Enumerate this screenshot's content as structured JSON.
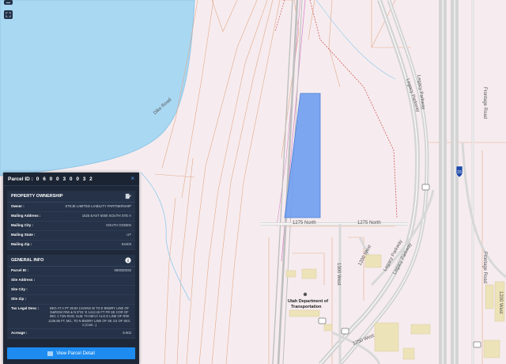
{
  "map": {
    "road_labels": {
      "dike_road": "Dike Road",
      "street_1275_a": "1275 North",
      "street_1275_b": "1275 North",
      "legacy_1": "Legacy Parkway",
      "legacy_2": "Legacy Parkway",
      "legacy_3": "Legacy Parkway",
      "legacy_4": "Legacy Parkway",
      "frontage_1": "Frontage Road",
      "frontage_2": "Frontage Road",
      "west_1200": "1200 West",
      "west_1300": "1300 West",
      "west_1200b": "1200 West",
      "west_1250": "1250 West"
    },
    "poi_utah_dot": "Utah Department of Transportation",
    "interstate_shield": "15",
    "parcel_highlight_color": "#6f9ff0",
    "water_color": "#a9d8f3"
  },
  "toolbar": {
    "zoom_button_icon": "minus-icon",
    "locate_button_icon": "expand-icon"
  },
  "panel": {
    "title": "Parcel ID :",
    "parcel_id": "0 6 0 0 3 0 0 3 2",
    "close_icon": "close-icon",
    "ownership": {
      "heading": "PROPERTY OWNERSHIP",
      "rows": [
        {
          "key": "Owner :",
          "value": "STEJE LIMITED LIABILITY PARTNERSHIP"
        },
        {
          "key": "Mailing Address :",
          "value": "1525 EAST 6000 SOUTH STE A"
        },
        {
          "key": "Mailing City :",
          "value": "SOUTH OGDEN"
        },
        {
          "key": "Mailing State :",
          "value": "UT"
        },
        {
          "key": "Mailing Zip :",
          "value": "84403"
        }
      ]
    },
    "general": {
      "heading": "GENERAL INFO",
      "rows": [
        {
          "key": "Parcel ID :",
          "value": "060030032"
        },
        {
          "key": "Site Address :",
          "value": ""
        },
        {
          "key": "Site City :",
          "value": ""
        },
        {
          "key": "Site Zip :",
          "value": ""
        },
        {
          "key": "Tax Legal Desc :",
          "value": "BEG AT A PT 28.92 CHAINS W TO E BNDRY LINE OF D&RGW R/W & N 9°01' E 1413.15 FT FR SE COR OF SEC 1 T2N-R1W, SLM; TH NE'LY ALG E LINE OF R/W 1226.85 FT, M/L, TO N BNDRY LINE OF SE 1/4 OF SEC 1 (Cont...)"
        },
        {
          "key": "Acreage :",
          "value": "9.002"
        }
      ]
    },
    "detail_button": "View Parcel Detail"
  }
}
